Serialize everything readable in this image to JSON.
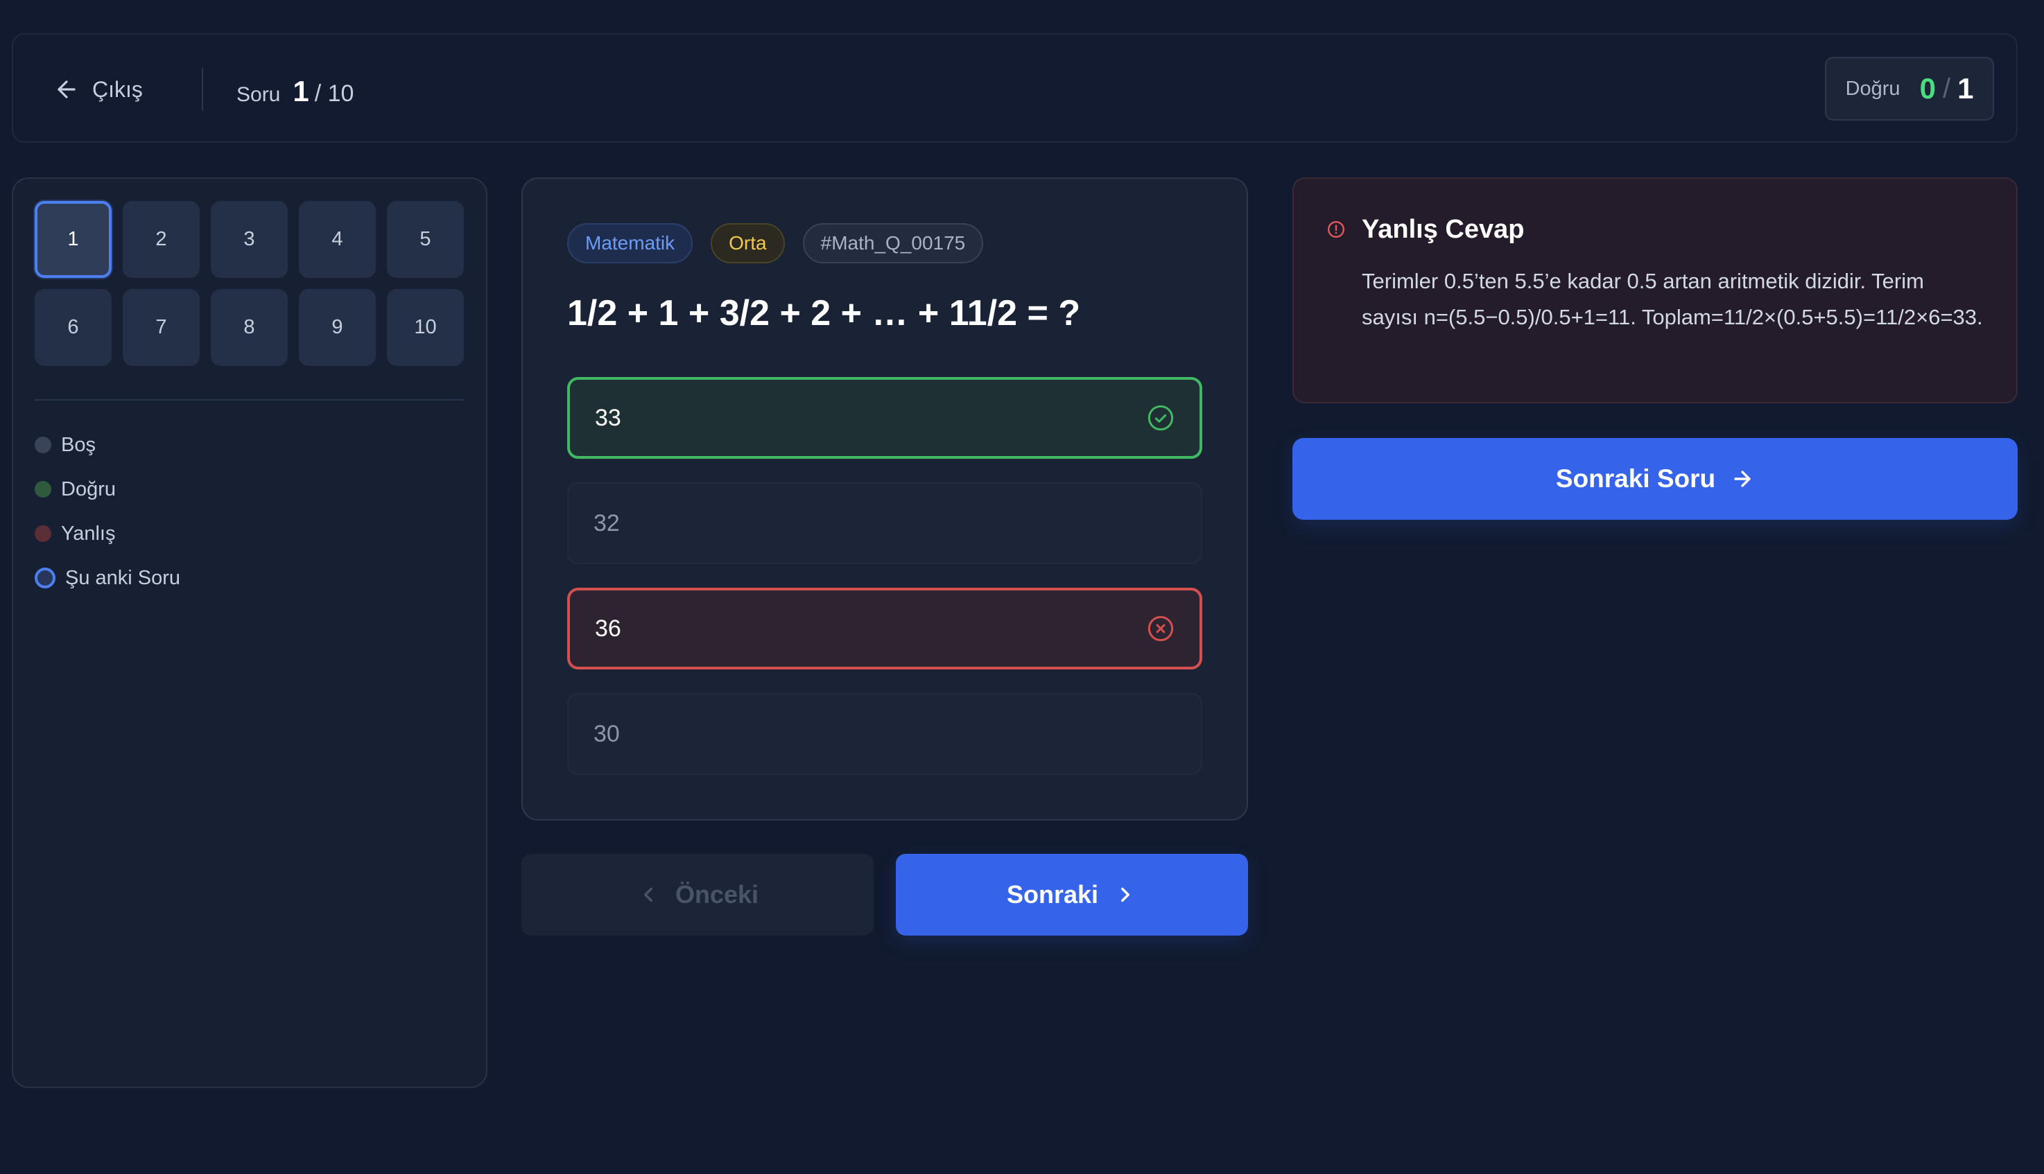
{
  "header": {
    "exit_label": "Çıkış",
    "progress_label": "Soru",
    "current_question": "1",
    "total_questions": "/ 10",
    "score_label": "Doğru",
    "score_correct": "0",
    "score_sep": "/",
    "score_total": "1"
  },
  "sidebar": {
    "questions": [
      "1",
      "2",
      "3",
      "4",
      "5",
      "6",
      "7",
      "8",
      "9",
      "10"
    ],
    "current_index": 0,
    "legend": [
      {
        "label": "Boş",
        "color": "#3a4459"
      },
      {
        "label": "Doğru",
        "color": "#2f5a3e"
      },
      {
        "label": "Yanlış",
        "color": "#5c2f38"
      },
      {
        "label": "Şu anki Soru",
        "color": "#4d7ff0"
      }
    ]
  },
  "question": {
    "tags": {
      "subject": "Matematik",
      "level": "Orta",
      "id": "#Math_Q_00175"
    },
    "text": "1/2 + 1 + 3/2 + 2 + … + 11/2 = ?",
    "options": [
      {
        "label": "33",
        "state": "correct"
      },
      {
        "label": "32",
        "state": "neutral"
      },
      {
        "label": "36",
        "state": "wrong"
      },
      {
        "label": "30",
        "state": "neutral"
      }
    ]
  },
  "navigation": {
    "prev_label": "Önceki",
    "next_label": "Sonraki"
  },
  "feedback": {
    "title": "Yanlış Cevap",
    "explanation": "Terimler 0.5’ten 5.5’e kadar 0.5 artan aritmetik dizidir. Terim sayısı n=(5.5−0.5)/0.5+1=11. Toplam=11/2×(0.5+5.5)=11/2×6=33.",
    "next_question_label": "Sonraki Soru"
  },
  "colors": {
    "accent": "#3563e9",
    "correct": "#41b862",
    "wrong": "#d4504f",
    "background": "#111a2e"
  }
}
